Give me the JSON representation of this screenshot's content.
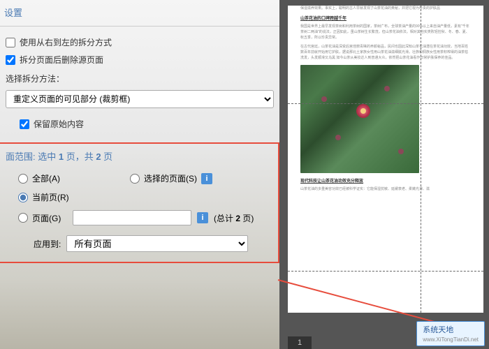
{
  "settings": {
    "title": "设置",
    "rtl_split": "使用从右到左的拆分方式",
    "delete_source": "拆分页面后删除源页面",
    "method_label": "选择拆分方法：",
    "method_value": "重定义页面的可见部分 (裁剪框)",
    "keep_original": "保留原始内容"
  },
  "range": {
    "title_prefix": "面范围: 选中 ",
    "selected": "1",
    "mid": " 页，共 ",
    "total": "2",
    "suffix": " 页",
    "all": "全部(A)",
    "selected_pages": "选择的页面(S)",
    "current": "当前页(R)",
    "page": "页面(G)",
    "total_label_prefix": "(总计 ",
    "total_label_suffix": " 页)",
    "apply_to": "应用到:",
    "apply_value": "所有页面"
  },
  "doc": {
    "para0": "保湿滋养效果。事实上，聪明的古人早就发现了山茶花油的奥秘，并把它视为珍贵的护肤品",
    "heading1": "山茶花油的口碑跨越千年",
    "para1": "我国是世界上最早发现茶树和利用茶树的国家，茶树广布，全球茶油产量的90%以上来自油产量低，素有\"千年茶树二两油\"的说法，正因如此，虽山茶树生长繁茂，但山茶花油依法。相对其他实类败轻控秋、冬、春、夏、秋五季，所以珍贵异常。",
    "para2": "在古代宫廷，山茶花油是深受后宫佳丽青睐的养颜秘品，民间也因此深知山茶花油潜在茶花油功效，当地百姓数百年前就开始用它护肤，据说那北土家族女性用山茶花油滋细腻光滑。壮族和侗族女性用茶籽榨得的油茶枯洗发，头发顺滑又乌黑 如今山茶从美妆达人到普通大众，依然把山茶花油看作日常护肤保养的佳品。",
    "heading2": "现代科技让山茶花油功效充分释放",
    "para3": "山茶花油的多重美容功效已经被科学证实：它能保湿抗敏、延缓衰老、柔嫩光滑、滋",
    "page_num": "1"
  },
  "watermark": "系统天地",
  "watermark_url": "www.XiTongTianDi.net"
}
